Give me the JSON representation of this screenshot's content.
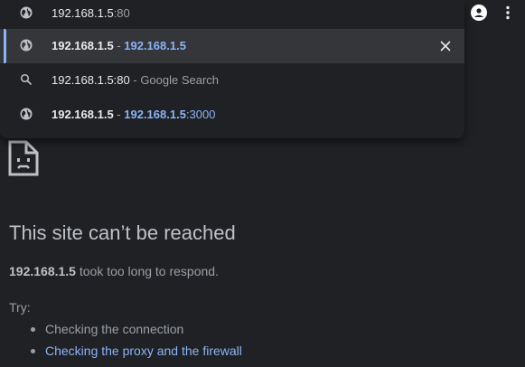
{
  "omnibox": {
    "input_host": "192.168.1.5",
    "input_port": ":80",
    "suggestions": [
      {
        "icon": "globe-icon",
        "title": "192.168.1.5",
        "separator": " - ",
        "url_bold": "192.168.1.5",
        "url_rest": "",
        "selected": true
      },
      {
        "icon": "search-icon",
        "title": "192.168.1.5:80",
        "separator": " - ",
        "hint": "Google Search"
      },
      {
        "icon": "globe-icon",
        "title": "192.168.1.5",
        "separator": " - ",
        "url_bold": "192.168.1.5",
        "url_rest": ":3000"
      }
    ]
  },
  "toolbar": {
    "profile_icon": "person-icon",
    "menu_icon": "kebab-menu-icon"
  },
  "error": {
    "icon": "sad-document-icon",
    "title": "This site can’t be reached",
    "host": "192.168.1.5",
    "message": " took too long to respond.",
    "try_label": "Try:",
    "suggestions": [
      {
        "text": "Checking the connection",
        "link": false
      },
      {
        "text": "Checking the proxy and the firewall",
        "link": true
      }
    ]
  },
  "colors": {
    "background": "#202124",
    "selected_row": "#35363a",
    "link": "#8ab4f8",
    "text": "#e8eaed",
    "muted": "#9aa0a6"
  }
}
